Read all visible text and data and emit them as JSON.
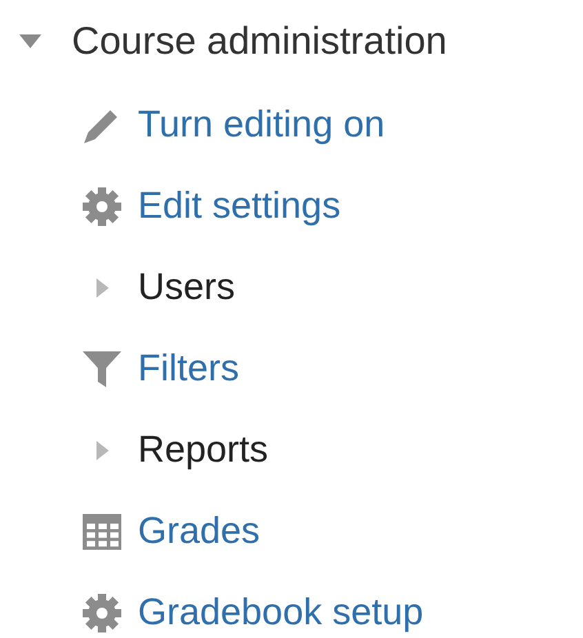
{
  "tree": {
    "label": "Course administration",
    "expanded": true,
    "children": [
      {
        "kind": "edit",
        "label": "Turn editing on"
      },
      {
        "kind": "settings",
        "label": "Edit settings"
      },
      {
        "kind": "branch",
        "label": "Users",
        "expanded": false
      },
      {
        "kind": "filter",
        "label": "Filters"
      },
      {
        "kind": "branch",
        "label": "Reports",
        "expanded": false
      },
      {
        "kind": "grades",
        "label": "Grades"
      },
      {
        "kind": "settings",
        "label": "Gradebook setup"
      }
    ]
  }
}
